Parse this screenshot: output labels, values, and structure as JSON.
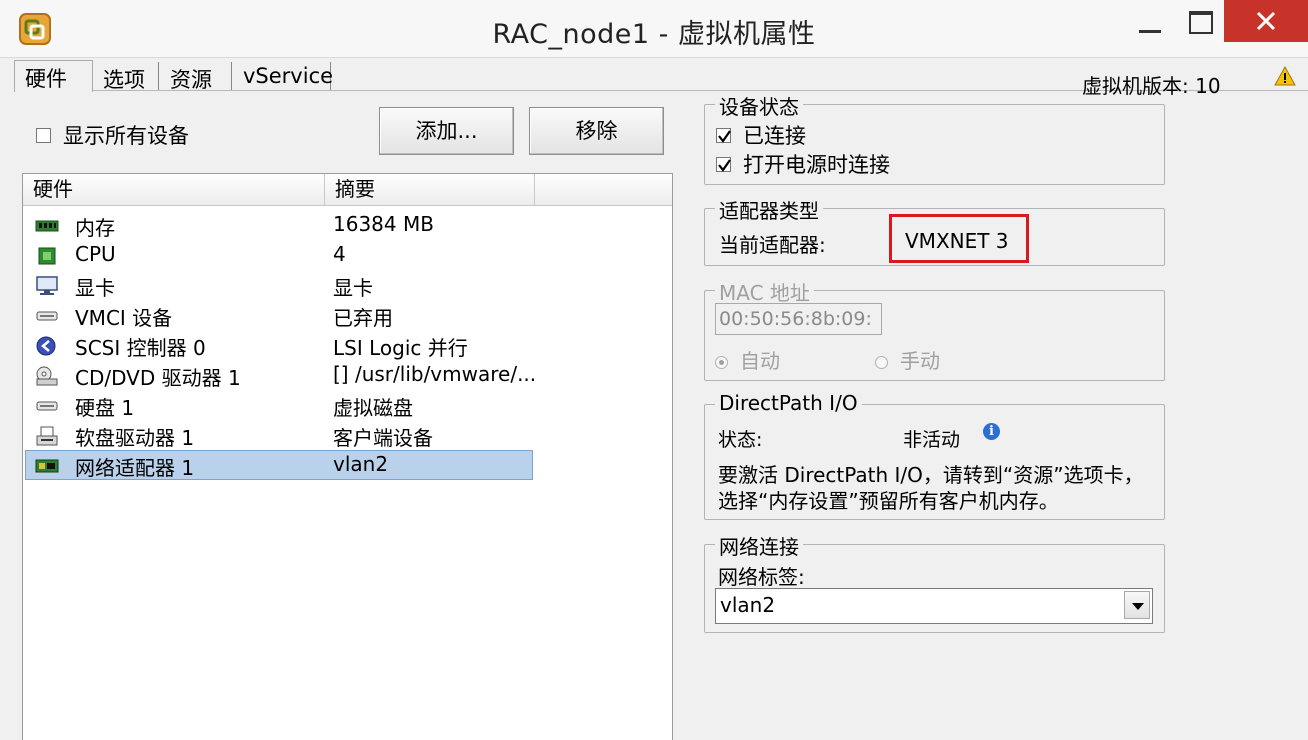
{
  "window": {
    "title": "RAC_node1 - 虚拟机属性"
  },
  "tabs": [
    {
      "label": "硬件",
      "active": true
    },
    {
      "label": "选项",
      "active": false
    },
    {
      "label": "资源",
      "active": false
    },
    {
      "label": "vService",
      "active": false
    }
  ],
  "version_label": "虚拟机版本: 10",
  "show_all_devices": {
    "label": "显示所有设备",
    "checked": false
  },
  "buttons": {
    "add": "添加...",
    "remove": "移除"
  },
  "hardware_list": {
    "columns": [
      "硬件",
      "摘要"
    ],
    "rows": [
      {
        "icon": "memory-icon",
        "name": "内存",
        "summary": "16384 MB"
      },
      {
        "icon": "cpu-icon",
        "name": "CPU",
        "summary": "4"
      },
      {
        "icon": "display-icon",
        "name": "显卡",
        "summary": "显卡"
      },
      {
        "icon": "vmci-device-icon",
        "name": "VMCI 设备",
        "summary": "已弃用"
      },
      {
        "icon": "scsi-controller-icon",
        "name": "SCSI 控制器 0",
        "summary": "LSI Logic 并行"
      },
      {
        "icon": "cd-dvd-icon",
        "name": "CD/DVD 驱动器 1",
        "summary": "[] /usr/lib/vmware/..."
      },
      {
        "icon": "hard-disk-icon",
        "name": "硬盘 1",
        "summary": "虚拟磁盘"
      },
      {
        "icon": "floppy-drive-icon",
        "name": "软盘驱动器 1",
        "summary": "客户端设备"
      },
      {
        "icon": "network-adapter-icon",
        "name": "网络适配器 1",
        "summary": "vlan2",
        "selected": true
      }
    ]
  },
  "device_status": {
    "title": "设备状态",
    "connected": {
      "label": "已连接",
      "checked": true
    },
    "connect_at_power_on": {
      "label": "打开电源时连接",
      "checked": true
    }
  },
  "adapter_type": {
    "title": "适配器类型",
    "current_label": "当前适配器:",
    "current_value": "VMXNET 3"
  },
  "mac_address": {
    "title": "MAC 地址",
    "value": "00:50:56:8b:09:",
    "auto_label": "自动",
    "manual_label": "手动",
    "selected": "auto"
  },
  "directpath": {
    "title": "DirectPath I/O",
    "status_label": "状态:",
    "status_value": "非活动",
    "note_line1": "要激活 DirectPath I/O，请转到“资源”选项卡，",
    "note_line2": "选择“内存设置”预留所有客户机内存。"
  },
  "network_connection": {
    "title": "网络连接",
    "label_caption": "网络标签:",
    "selected_value": "vlan2"
  },
  "colors": {
    "close_button": "#c7332b",
    "selection": "#b9d1ea",
    "highlight_box": "#d8191e",
    "info_icon": "#2c6fd1"
  }
}
